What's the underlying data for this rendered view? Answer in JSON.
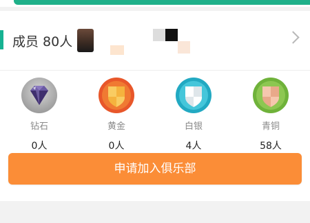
{
  "members": {
    "label": "成员 80人"
  },
  "levels": [
    {
      "name": "钻石",
      "count": "0人",
      "icon": "diamond-icon",
      "color": "#8a8a8a"
    },
    {
      "name": "黄金",
      "count": "0人",
      "icon": "gold-shield-icon",
      "color": "#f08a2a"
    },
    {
      "name": "白银",
      "count": "4人",
      "icon": "silver-shield-icon",
      "color": "#28b6c9"
    },
    {
      "name": "青铜",
      "count": "58人",
      "icon": "bronze-shield-icon",
      "color": "#7ab842"
    }
  ],
  "join_button": {
    "label": "申请加入俱乐部",
    "color": "#fb8d37"
  },
  "accent_color": "#1fb089"
}
